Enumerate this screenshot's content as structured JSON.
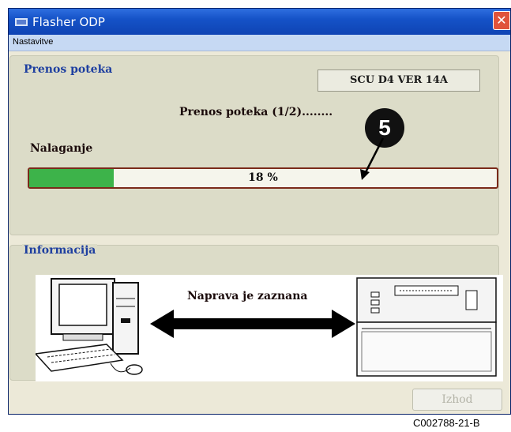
{
  "window": {
    "title": "Flasher ODP",
    "close_icon": "close-icon"
  },
  "menu": {
    "items": [
      "Nastavitve"
    ]
  },
  "transfer_group": {
    "legend": "Prenos poteka",
    "version": "SCU D4 VER  14A",
    "status": "Prenos poteka (1/2)........",
    "loading_label": "Nalaganje",
    "progress": {
      "percent": 18,
      "label": "18 %"
    }
  },
  "callout": {
    "number": "5"
  },
  "info_group": {
    "legend": "Informacija",
    "device_status": "Naprava je zaznana"
  },
  "buttons": {
    "exit": "Izhod"
  },
  "caption": "C002788-21-B",
  "colors": {
    "titlebar": "#1552c7",
    "progress_fill": "#3db34a",
    "legend": "#1e3fa0",
    "close": "#e0533b"
  }
}
